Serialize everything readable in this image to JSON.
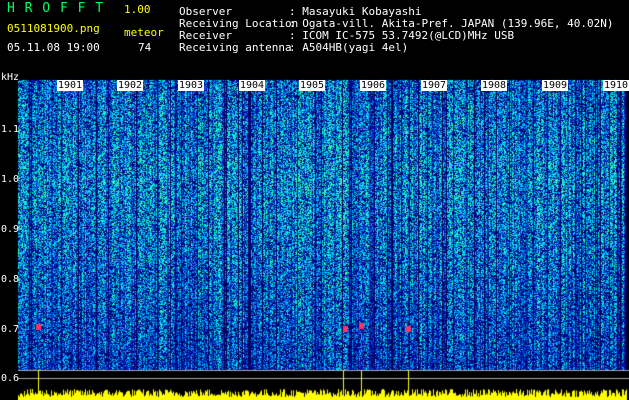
{
  "header": {
    "app_title": "H R O F F T",
    "version": "1.00",
    "filename": "0511081900.png",
    "datetime": "05.11.08 19:00",
    "counter_label": "meteor",
    "counter_value": "74",
    "observer_label": "Observer",
    "observer_value": ": Masayuki Kobayashi",
    "location_label": "Receiving Location",
    "location_value": ": Ogata-vill. Akita-Pref. JAPAN (139.96E, 40.02N)",
    "receiver_label": "Receiver",
    "receiver_value": ": ICOM IC-575 53.7492(@LCD)MHz USB",
    "antenna_label": "Receiving antenna",
    "antenna_value": ": A504HB(yagi 4el)"
  },
  "spectrogram": {
    "unit_label": "kHz",
    "y_ticks": [
      "1.1",
      "1.0",
      "0.9",
      "0.8",
      "0.7",
      "0.6"
    ],
    "minute_marks": [
      "1901",
      "1902",
      "1903",
      "1904",
      "1905",
      "1906",
      "1907",
      "1908",
      "1909",
      "1910"
    ],
    "colors": {
      "background": "#000000",
      "low": "#0000aa",
      "mid": "#0088ff",
      "high": "#00ff88",
      "peak": "#ffff00",
      "echo": "#ff3366"
    }
  }
}
